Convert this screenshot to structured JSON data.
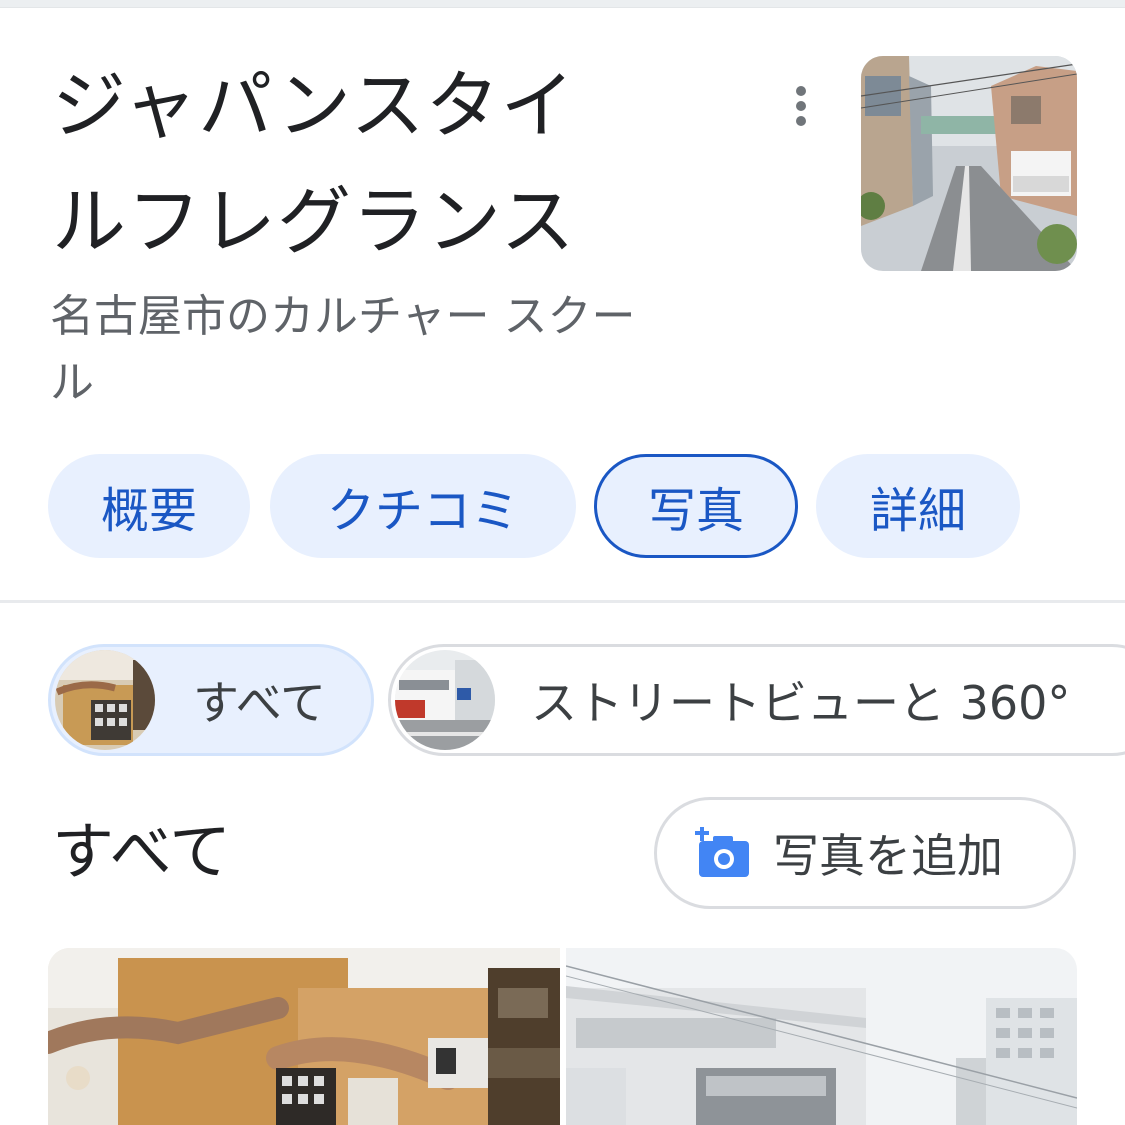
{
  "place": {
    "name_line1": "ジャパンスタイ",
    "name_line2": "ルフレグランス",
    "category_line1": "名古屋市のカルチャー スクー",
    "category_line2": "ル"
  },
  "header_icons": {
    "more": "more-vert-icon",
    "thumbnail": "street-thumbnail"
  },
  "tabs": [
    {
      "label": "概要",
      "active": false
    },
    {
      "label": "クチコミ",
      "active": false
    },
    {
      "label": "写真",
      "active": true
    },
    {
      "label": "詳細",
      "active": false
    }
  ],
  "photo_filters": [
    {
      "label": "すべて",
      "selected": true
    },
    {
      "label": "ストリートビューと 360°",
      "selected": false
    }
  ],
  "photos_section": {
    "title": "すべて",
    "add_photo_label": "写真を追加",
    "add_photo_icon": "add-photo-camera-icon"
  },
  "colors": {
    "accent": "#1a57c4",
    "chip_bg": "#e8f0fe",
    "text_primary": "#202124",
    "text_secondary": "#5f6368",
    "camera_icon": "#4285f4"
  }
}
